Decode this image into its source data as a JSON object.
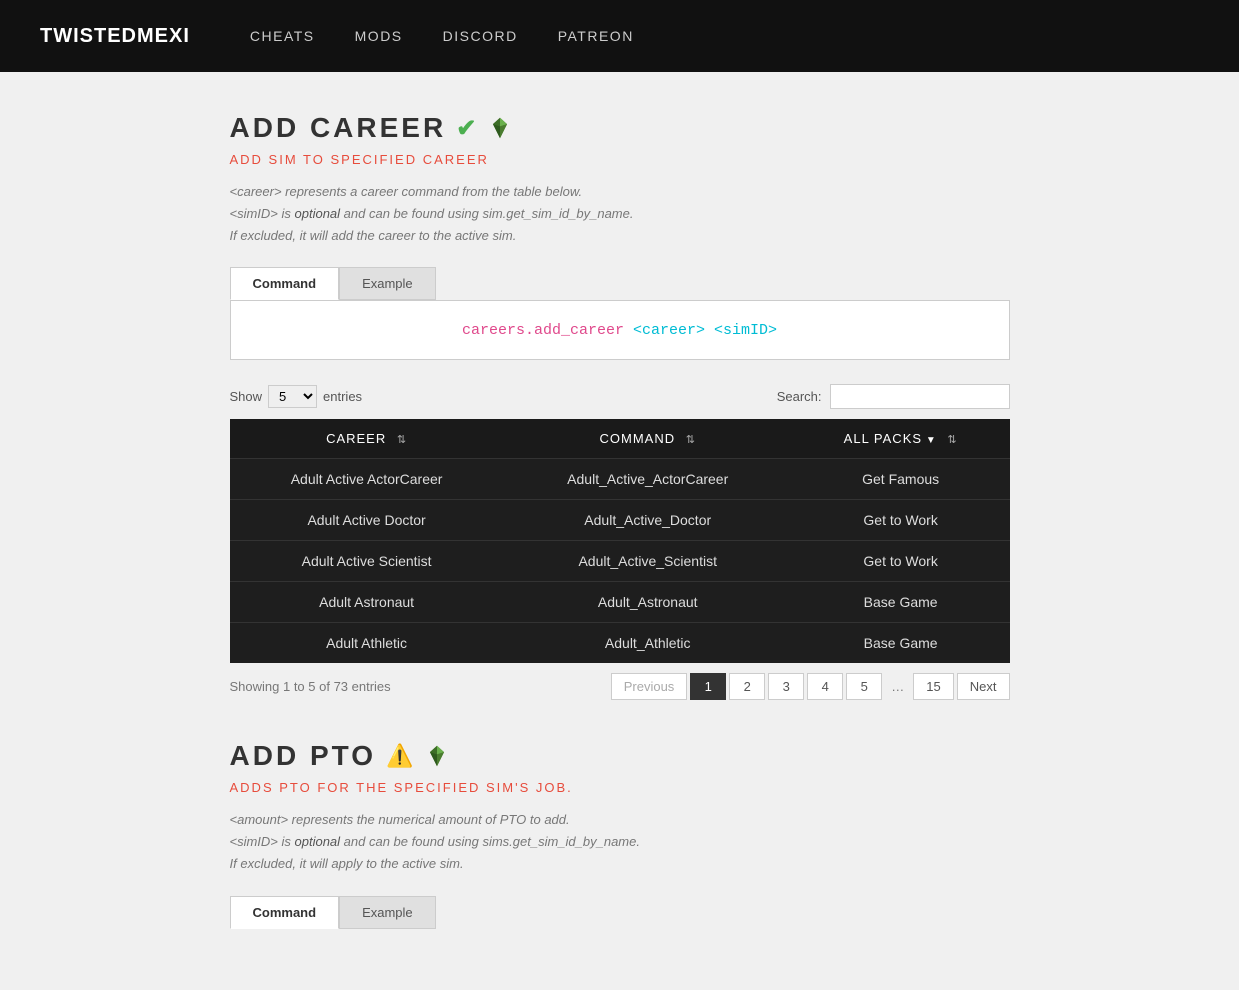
{
  "navbar": {
    "brand": "TWISTEDMEXI",
    "links": [
      {
        "label": "CHEATS",
        "href": "#"
      },
      {
        "label": "MODS",
        "href": "#"
      },
      {
        "label": "DISCORD",
        "href": "#"
      },
      {
        "label": "PATREON",
        "href": "#"
      }
    ]
  },
  "add_career": {
    "title": "ADD CAREER",
    "subtitle": "ADD SIM TO SPECIFIED CAREER",
    "description_lines": [
      "<career> represents a career command from the table below.",
      "<simID> is optional and can be found using sim.get_sim_id_by_name.",
      "If excluded, it will add the career to the active sim."
    ],
    "tabs": [
      {
        "label": "Command",
        "active": true
      },
      {
        "label": "Example",
        "active": false
      }
    ],
    "command": "careers.add_career <career> <simID>",
    "show_label": "Show",
    "show_value": "5",
    "entries_label": "entries",
    "search_label": "Search:",
    "table": {
      "columns": [
        {
          "label": "CAREER"
        },
        {
          "label": "COMMAND"
        },
        {
          "label": "ALL PACKS",
          "has_dropdown": true
        }
      ],
      "rows": [
        {
          "career": "Adult Active ActorCareer",
          "command": "Adult_Active_ActorCareer",
          "pack": "Get Famous"
        },
        {
          "career": "Adult Active Doctor",
          "command": "Adult_Active_Doctor",
          "pack": "Get to Work"
        },
        {
          "career": "Adult Active Scientist",
          "command": "Adult_Active_Scientist",
          "pack": "Get to Work"
        },
        {
          "career": "Adult Astronaut",
          "command": "Adult_Astronaut",
          "pack": "Base Game"
        },
        {
          "career": "Adult Athletic",
          "command": "Adult_Athletic",
          "pack": "Base Game"
        }
      ]
    },
    "pagination": {
      "showing_text": "Showing 1 to 5 of 73 entries",
      "previous_label": "Previous",
      "next_label": "Next",
      "pages": [
        "1",
        "2",
        "3",
        "4",
        "5",
        "...",
        "15"
      ],
      "active_page": "1"
    }
  },
  "add_pto": {
    "title": "ADD PTO",
    "subtitle": "ADDS PTO FOR THE SPECIFIED SIM'S JOB.",
    "description_lines": [
      "<amount> represents the numerical amount of PTO to add.",
      "<simID> is optional and can be found using sims.get_sim_id_by_name.",
      "If excluded, it will apply to the active sim."
    ],
    "tabs": [
      {
        "label": "Command",
        "active": true
      },
      {
        "label": "Example",
        "active": false
      }
    ]
  }
}
